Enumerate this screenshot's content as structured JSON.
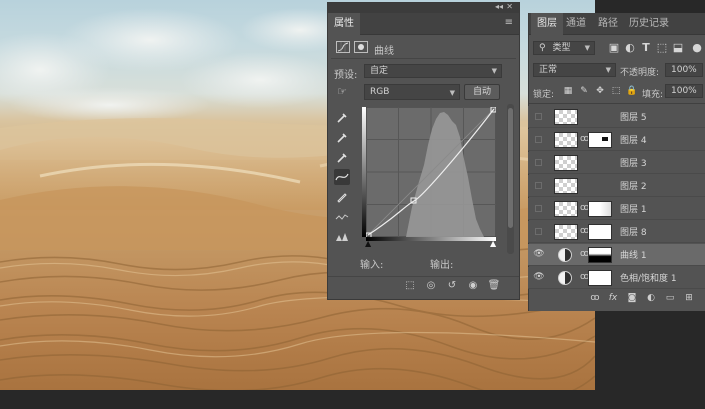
{
  "properties_panel": {
    "tab_label": "属性",
    "header_title": "曲线",
    "preset_label": "预设:",
    "preset_value": "自定",
    "channel_value": "RGB",
    "auto_button": "自动",
    "input_label": "输入:",
    "output_label": "输出:",
    "icons": [
      "curves-adjustment-icon",
      "layer-mask-icon",
      "target-adjust-icon",
      "black-point-eyedropper-icon",
      "gray-point-eyedropper-icon",
      "white-point-eyedropper-icon",
      "curve-edit-points-icon",
      "pencil-draw-icon",
      "smooth-icon",
      "clipping-warning-icon",
      "clip-to-layer-icon",
      "view-previous-state-icon",
      "reset-icon",
      "visibility-icon",
      "delete-icon"
    ]
  },
  "layers_panel": {
    "tabs": [
      "图层",
      "通道",
      "路径",
      "历史记录"
    ],
    "active_tab": "图层",
    "filter_kind": "类型",
    "blend_mode": "正常",
    "opacity_label": "不透明度:",
    "opacity_value": "100%",
    "lock_label": "锁定:",
    "fill_label": "填充:",
    "fill_value": "100%",
    "layers": [
      {
        "name": "图层 5",
        "visible": false,
        "kind": "pixel",
        "mask": false
      },
      {
        "name": "图层 4",
        "visible": false,
        "kind": "smart",
        "mask": true
      },
      {
        "name": "图层 3",
        "visible": false,
        "kind": "pixel",
        "mask": false
      },
      {
        "name": "图层 2",
        "visible": false,
        "kind": "pixel",
        "mask": false
      },
      {
        "name": "图层 1",
        "visible": false,
        "kind": "pixel",
        "mask": true
      },
      {
        "name": "图层 8",
        "visible": false,
        "kind": "smart",
        "mask": true
      },
      {
        "name": "曲线 1",
        "visible": true,
        "kind": "adjustment",
        "mask": true,
        "selected": true
      },
      {
        "name": "色相/饱和度 1",
        "visible": true,
        "kind": "adjustment",
        "mask": true
      }
    ]
  },
  "colors": {
    "panel_bg": "#535353",
    "panel_dark": "#424242",
    "selected_row": "#6a6a6a",
    "app_bg": "#282828"
  }
}
